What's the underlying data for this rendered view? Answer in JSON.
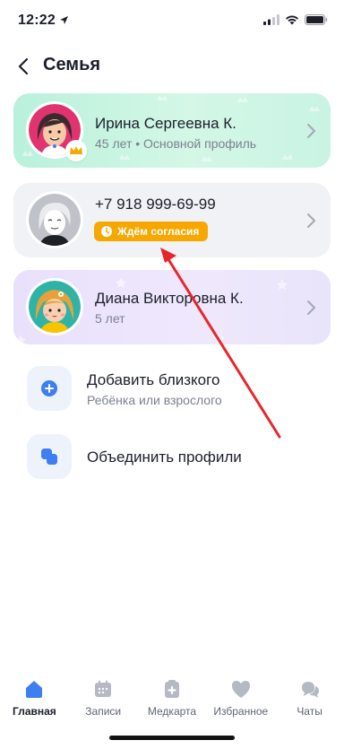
{
  "status_bar": {
    "time": "12:22"
  },
  "header": {
    "title": "Семья"
  },
  "members": [
    {
      "name": "Ирина Сергеевна К.",
      "details": "45 лет • Основной профиль"
    },
    {
      "name": "+7 918 999-69-99",
      "badge": "Ждём согласия"
    },
    {
      "name": "Диана Викторовна К.",
      "details": "5 лет"
    }
  ],
  "actions": [
    {
      "title": "Добавить близкого",
      "subtitle": "Ребёнка или взрослого"
    },
    {
      "title": "Объединить профили"
    }
  ],
  "tabbar": {
    "active": "Главная",
    "tabs": [
      {
        "label": "Главная",
        "icon": "home-icon"
      },
      {
        "label": "Записи",
        "icon": "calendar-icon"
      },
      {
        "label": "Медкарта",
        "icon": "medcard-icon"
      },
      {
        "label": "Избранное",
        "icon": "heart-icon"
      },
      {
        "label": "Чаты",
        "icon": "chat-icon"
      }
    ]
  },
  "colors": {
    "accent": "#3d7ef0",
    "badge_orange": "#f6a800",
    "annotation_red": "#e8262a",
    "primary_card": "#c6f3df",
    "child_card": "#ebe3fc",
    "pending_card": "#f0f2f5"
  }
}
